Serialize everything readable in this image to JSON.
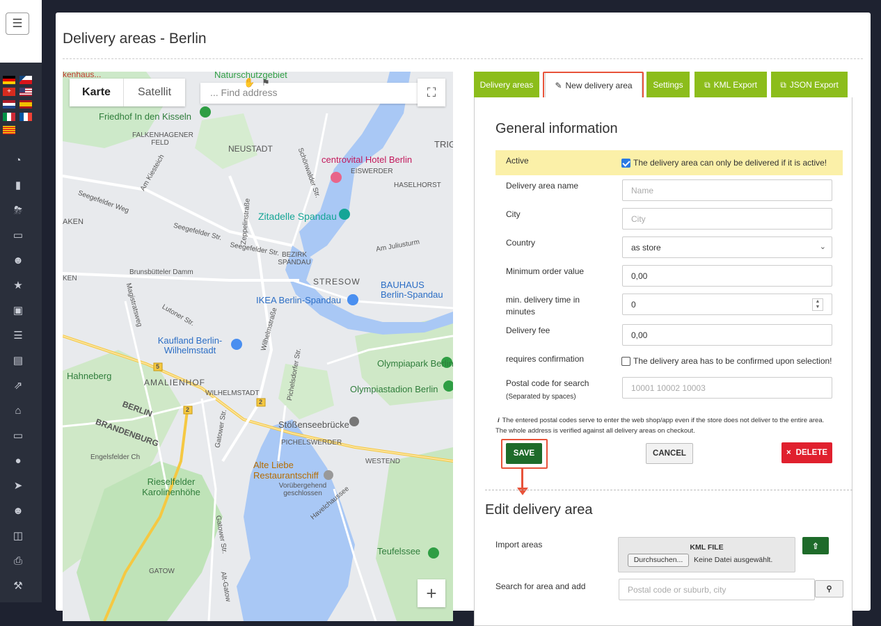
{
  "page": {
    "title": "Delivery areas - Berlin"
  },
  "sidebar": {
    "menu_icon": "menu-icon",
    "flags": [
      "de",
      "cz",
      "ch",
      "us",
      "nl",
      "es",
      "it",
      "fr",
      "ca"
    ],
    "icons": [
      "dashboard-icon",
      "chart-icon",
      "cart-icon",
      "monitor-icon",
      "user-plus-icon",
      "star-icon",
      "archive-icon",
      "list-icon",
      "book-icon",
      "trend-icon",
      "home-icon",
      "screen-icon",
      "user-icon",
      "rocket-icon",
      "users-icon",
      "database-icon",
      "print-icon",
      "wrench-icon"
    ]
  },
  "map": {
    "tab_map": "Karte",
    "tab_satellite": "Satellit",
    "search_placeholder": "... Find address",
    "labels": {
      "top_left": "kenhaus...",
      "naturschutz": "Naturschutzgebiet",
      "friedhof": "Friedhof In den Kisseln",
      "falkenhagener": "FALKENHAGENER FELD",
      "neustadt": "NEUSTADT",
      "trigo": "TRIGO Bu",
      "hotel": "centrovital Hotel Berlin",
      "eiswerder": "EISWERDER",
      "haselhorst": "HASELHORST",
      "zitadelle": "Zitadelle Spandau",
      "bezirk": "BEZIRK SPANDAU",
      "kiesteich": "Am Kiesteich",
      "seegefelder_weg": "Seegefelder Weg",
      "seegefelder_str": "Seegefelder Str.",
      "seegefelder_str2": "Seegefelder Str.",
      "juliusturm": "Am Juliusturm",
      "schoenwalder": "Schönwalder Str.",
      "zeppelin": "Zeppelinstraße",
      "brunsbuetteler": "Brunsbütteler Damm",
      "stresow": "STRESOW",
      "bauhaus": "BAUHAUS Berlin-Spandau",
      "ikea": "IKEA Berlin-Spandau",
      "magistrats": "Magistratsweg",
      "lutoner": "Lutoner Str.",
      "wilhelm": "Wilhelmstraße",
      "kaufland": "Kaufland Berlin-Wilhelmstadt",
      "olympiapark": "Olympiapark Berlin",
      "olympiastadion": "Olympiastadion Berlin",
      "hahneberg": "Hahneberg",
      "amalienhof": "AMALIENHOF",
      "wilhelmstadt": "WILHELMSTADT",
      "berlin": "BERLIN",
      "brandenburg": "BRANDENBURG",
      "pichelsdorfer": "Pichelsdorfer Str.",
      "gatower": "Gatower Str.",
      "stoessensee": "Stößenseebrücke",
      "pichelswerder": "PICHELSWERDER",
      "westend": "WESTEND",
      "engelsfelder": "Engelsfelder Ch",
      "alte_liebe": "Alte Liebe Restaurantschiff",
      "vorubergehend": "Vorübergehend geschlossen",
      "rieselfelder": "Rieselfelder Karolinenhöhe",
      "havelchaussee": "Havelchaussee",
      "teufelssee": "Teufelssee",
      "gatow": "GATOW",
      "alt_gatow": "Alt-Gatow",
      "road5": "5",
      "road2a": "2",
      "road2b": "2",
      "aken": "AKEN",
      "ken": "KEN",
      "kladow_str": "Gatower Str."
    },
    "zoom_in": "+"
  },
  "tabs": [
    {
      "label": "Delivery areas",
      "active": false
    },
    {
      "label": "New delivery area",
      "active": true
    },
    {
      "label": "Settings",
      "active": false
    },
    {
      "label": "KML Export",
      "active": false
    },
    {
      "label": "JSON Export",
      "active": false
    }
  ],
  "general": {
    "heading": "General information",
    "active_label": "Active",
    "active_checkbox_text": "The delivery area can only be delivered if it is active!",
    "active_checked": true,
    "name_label": "Delivery area name",
    "name_placeholder": "Name",
    "city_label": "City",
    "city_placeholder": "City",
    "country_label": "Country",
    "country_value": "as store",
    "min_order_label": "Minimum order value",
    "min_order_value": "0,00",
    "min_time_label": "min. delivery time in minutes",
    "min_time_value": "0",
    "fee_label": "Delivery fee",
    "fee_value": "0,00",
    "confirm_label": "requires confirmation",
    "confirm_checkbox_text": "The delivery area has to be confirmed upon selection!",
    "confirm_checked": false,
    "postal_label": "Postal code for search",
    "postal_sublabel": "(Separated by spaces)",
    "postal_placeholder": "10001 10002 10003",
    "info_line1": "The entered postal codes serve to enter the web shop/app even if the store does not deliver to the entire area.",
    "info_line2": "The whole address is verified against all delivery areas on checkout.",
    "save_label": "SAVE",
    "cancel_label": "CANCEL",
    "delete_label": "DELETE",
    "delete_icon": "×"
  },
  "edit": {
    "heading": "Edit delivery area",
    "import_label": "Import areas",
    "kml_title": "KML FILE",
    "browse_label": "Durchsuchen...",
    "no_file_label": "Keine Datei ausgewählt.",
    "search_label": "Search for area and add",
    "search_placeholder": "Postal code or suburb, city"
  },
  "colors": {
    "tab_green": "#8cbd1b",
    "save_green": "#1e6b2a",
    "delete_red": "#e0202e",
    "highlight_red": "#e8533a",
    "active_row_bg": "#fbf0a8"
  }
}
